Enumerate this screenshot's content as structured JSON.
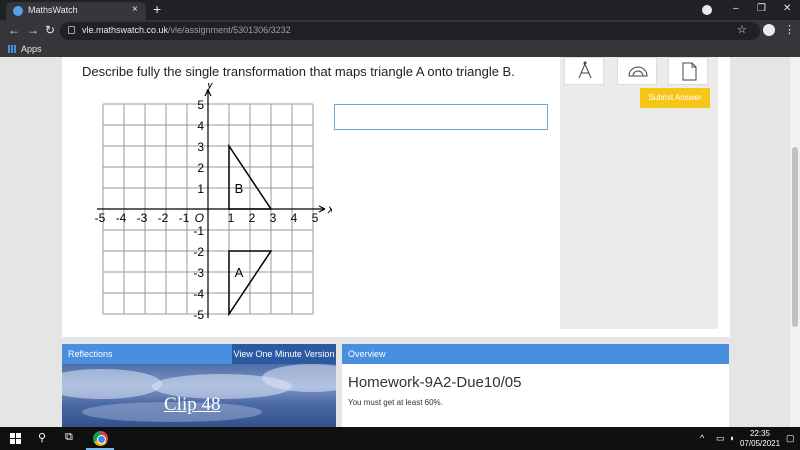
{
  "browser": {
    "tab_title": "MathsWatch",
    "tab_close": "×",
    "new_tab": "+",
    "url_domain": "vle.mathswatch.co.uk",
    "url_path": "/vle/assignment/5301306/3232",
    "bookmark_apps": "Apps",
    "minimize": "–",
    "maximize": "❐",
    "close": "✕"
  },
  "question": {
    "text": "Describe fully the single transformation that maps triangle A onto triangle B.",
    "answer_value": "",
    "submit_label": "Submit Answer"
  },
  "graph": {
    "x_axis_label": "x",
    "y_axis_label": "y",
    "origin_label": "O",
    "x_ticks": [
      "-5",
      "-4",
      "-3",
      "-2",
      "-1",
      "1",
      "2",
      "3",
      "4",
      "5"
    ],
    "y_ticks": [
      "5",
      "4",
      "3",
      "2",
      "1",
      "-1",
      "-2",
      "-3",
      "-4",
      "-5"
    ],
    "x_range": [
      -5,
      5
    ],
    "y_range": [
      -5,
      5
    ],
    "triangle_A": {
      "label": "A",
      "vertices": [
        [
          1,
          -2
        ],
        [
          3,
          -2
        ],
        [
          1,
          -5
        ]
      ]
    },
    "triangle_B": {
      "label": "B",
      "vertices": [
        [
          1,
          3
        ],
        [
          1,
          0
        ],
        [
          3,
          0
        ]
      ]
    }
  },
  "video": {
    "section_title": "Reflections",
    "view_button": "View One Minute Version",
    "clip_label": "Clip 48"
  },
  "overview": {
    "header": "Overview",
    "homework_title": "Homework-9A2-Due10/05",
    "requirement": "You must get at least 60%."
  },
  "taskbar": {
    "time": "22:35",
    "date": "07/05/2021"
  }
}
